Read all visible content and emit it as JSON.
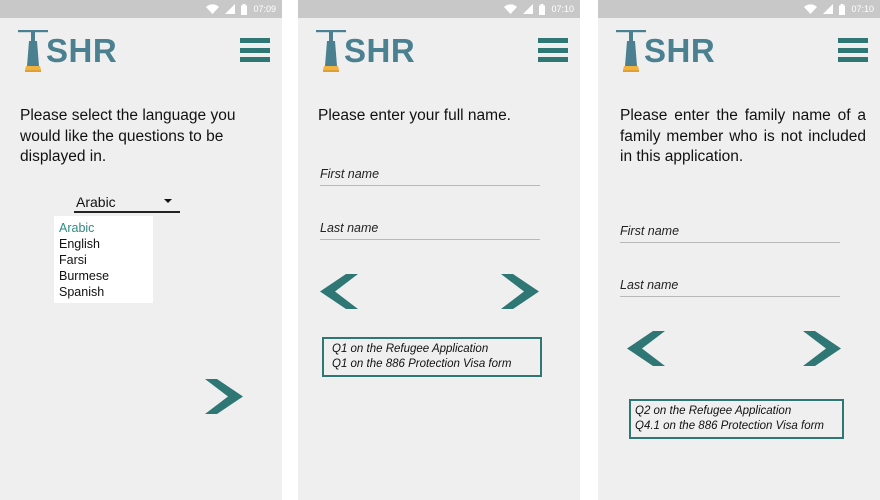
{
  "brand": {
    "logo_text": "SHR",
    "accent": "#2e7775",
    "logo_color": "#4a8090"
  },
  "screens": [
    {
      "time": "07:09",
      "question": "Please select the language you would like the questions to be displayed in.",
      "language_select": {
        "selected": "Arabic",
        "options": [
          "Arabic",
          "English",
          "Farsi",
          "Burmese",
          "Spanish"
        ]
      },
      "icons": {
        "next": "chevron-right-icon",
        "menu": "hamburger-menu-icon"
      }
    },
    {
      "time": "07:10",
      "question": "Please enter your full name.",
      "fields": {
        "first_name_placeholder": "First name",
        "last_name_placeholder": "Last name"
      },
      "reference": [
        "Q1 on the Refugee Application",
        "Q1 on the 886 Protection Visa form"
      ],
      "icons": {
        "back": "chevron-left-icon",
        "next": "chevron-right-icon"
      }
    },
    {
      "time": "07:10",
      "question": "Please enter the family name of a family member who is not included in this application.",
      "fields": {
        "first_name_placeholder": "First name",
        "last_name_placeholder": "Last name"
      },
      "reference": [
        "Q2 on the Refugee Application",
        "Q4.1 on the 886 Protection Visa form"
      ],
      "icons": {
        "back": "chevron-left-icon",
        "next": "chevron-right-icon"
      }
    }
  ]
}
